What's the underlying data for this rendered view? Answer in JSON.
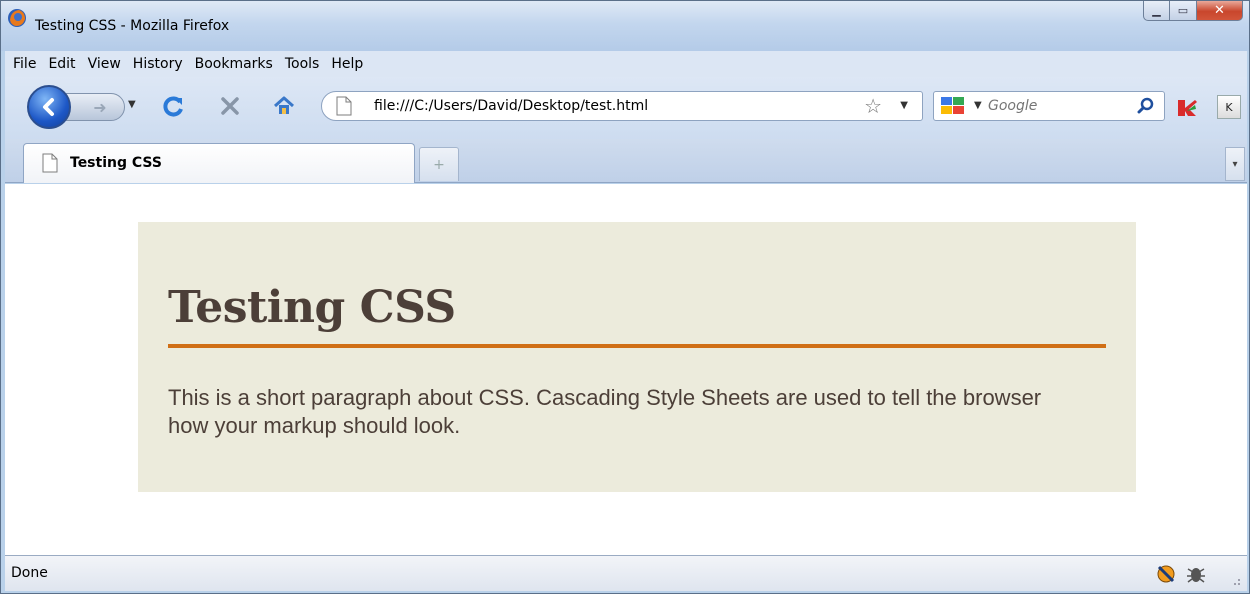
{
  "window": {
    "title": "Testing CSS - Mozilla Firefox",
    "controls": [
      "minimize",
      "maximize",
      "close"
    ]
  },
  "menu": {
    "items": [
      {
        "label": "File"
      },
      {
        "label": "Edit"
      },
      {
        "label": "View"
      },
      {
        "label": "History"
      },
      {
        "label": "Bookmarks"
      },
      {
        "label": "Tools"
      },
      {
        "label": "Help"
      }
    ]
  },
  "toolbar": {
    "icons": {
      "back": "back-arrow-icon",
      "forward": "forward-arrow-icon",
      "reload": "reload-icon",
      "stop": "stop-icon",
      "home": "home-icon"
    },
    "url": "file:///C:/Users/David/Desktop/test.html",
    "search": {
      "placeholder": "Google"
    },
    "colors": {
      "reload": "#2a7ad8",
      "stop": "#8896a8",
      "back_button": "#1d57c6"
    }
  },
  "tabs": [
    {
      "label": "Testing CSS",
      "active": true
    }
  ],
  "page": {
    "heading": "Testing CSS",
    "paragraph": "This is a short paragraph about CSS. Cascading Style Sheets are used to tell the browser how your markup should look.",
    "colors": {
      "panel_background": "#ecebdc",
      "heading_text": "#4c3f38",
      "rule": "#d06f16"
    }
  },
  "status": {
    "text": "Done"
  }
}
